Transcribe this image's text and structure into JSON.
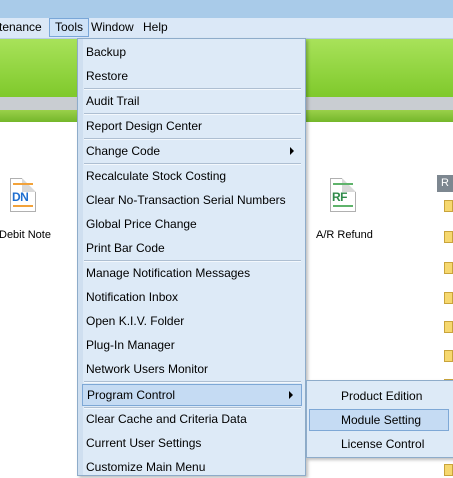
{
  "menubar": {
    "items": [
      {
        "label": "tenance"
      },
      {
        "label": "Tools"
      },
      {
        "label": "Window"
      },
      {
        "label": "Help"
      }
    ]
  },
  "desktop": {
    "icons": [
      {
        "tag": "DN",
        "label": "Debit Note",
        "color": "#1f6fd0"
      },
      {
        "tag": "RF",
        "label": "A/R Refund",
        "color": "#2f8a4a"
      }
    ],
    "right_panel_header": "R"
  },
  "tools_menu": {
    "items": [
      {
        "label": "Backup"
      },
      {
        "label": "Restore"
      },
      {
        "label": "Audit Trail"
      },
      {
        "label": "Report Design Center"
      },
      {
        "label": "Change Code"
      },
      {
        "label": "Recalculate Stock Costing"
      },
      {
        "label": "Clear No-Transaction Serial Numbers"
      },
      {
        "label": "Global Price Change"
      },
      {
        "label": "Print Bar Code"
      },
      {
        "label": "Manage Notification Messages"
      },
      {
        "label": "Notification Inbox"
      },
      {
        "label": "Open K.I.V. Folder"
      },
      {
        "label": "Plug-In Manager"
      },
      {
        "label": "Network Users Monitor"
      },
      {
        "label": "Program Control"
      },
      {
        "label": "Clear Cache and Criteria Data"
      },
      {
        "label": "Current User Settings"
      },
      {
        "label": "Customize Main Menu"
      }
    ]
  },
  "program_control_submenu": {
    "items": [
      {
        "label": "Product Edition"
      },
      {
        "label": "Module Setting"
      },
      {
        "label": "License Control"
      }
    ]
  },
  "colors": {
    "menu_bg": "#ddeaf7",
    "highlight": "#c5dbf3",
    "green_band": "#8fd53a"
  }
}
